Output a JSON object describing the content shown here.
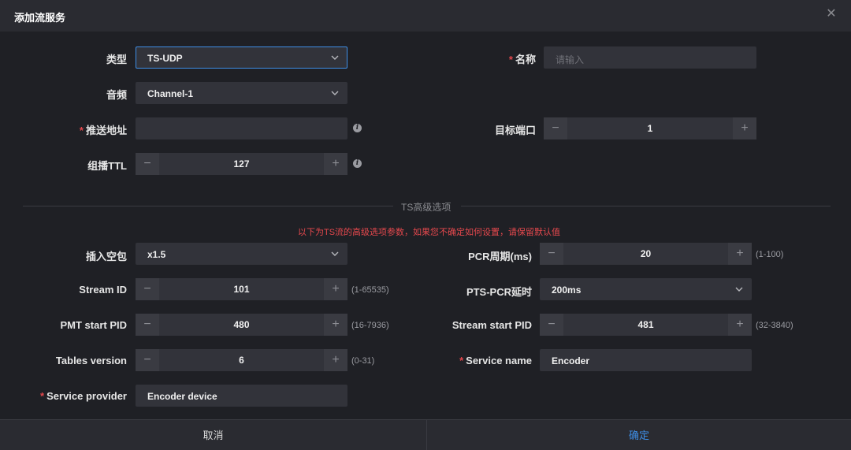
{
  "dialog": {
    "title": "添加流服务",
    "close_icon": "close-icon"
  },
  "form": {
    "type": {
      "label": "类型",
      "value": "TS-UDP"
    },
    "name": {
      "label": "名称",
      "placeholder": "请输入",
      "required": "*"
    },
    "audio": {
      "label": "音频",
      "value": "Channel-1"
    },
    "push_address": {
      "label": "推送地址",
      "value": "",
      "required": "*",
      "icon": "info-icon"
    },
    "target_port": {
      "label": "目标端口",
      "value": "1"
    },
    "multicast_ttl": {
      "label": "组播TTL",
      "value": "127",
      "icon": "info-icon"
    }
  },
  "section": {
    "title": "TS高级选项",
    "warning": "以下为TS流的高级选项参数，如果您不确定如何设置，请保留默认值"
  },
  "advanced": {
    "null_packet": {
      "label": "插入空包",
      "value": "x1.5"
    },
    "pcr_period": {
      "label": "PCR周期(ms)",
      "value": "20",
      "hint": "(1-100)"
    },
    "stream_id": {
      "label": "Stream ID",
      "value": "101",
      "hint": "(1-65535)"
    },
    "pts_pcr_delay": {
      "label": "PTS-PCR延时",
      "value": "200ms"
    },
    "pmt_start_pid": {
      "label": "PMT start PID",
      "value": "480",
      "hint": "(16-7936)"
    },
    "stream_start_pid": {
      "label": "Stream start PID",
      "value": "481",
      "hint": "(32-3840)"
    },
    "tables_version": {
      "label": "Tables version",
      "value": "6",
      "hint": "(0-31)"
    },
    "service_name": {
      "label": "Service name",
      "value": "Encoder",
      "required": "*"
    },
    "service_provider": {
      "label": "Service provider",
      "value": "Encoder device",
      "required": "*"
    }
  },
  "stepper": {
    "minus": "−",
    "plus": "+"
  },
  "footer": {
    "cancel": "取消",
    "confirm": "确定"
  },
  "colors": {
    "accent": "#3e8ee6",
    "required": "#e5484d",
    "background": "#1f2025"
  }
}
